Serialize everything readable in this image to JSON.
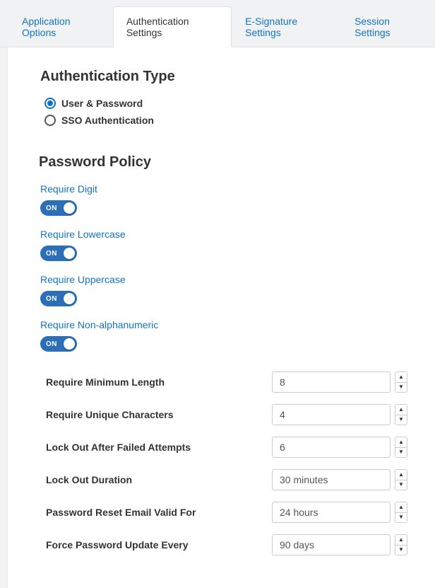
{
  "tabs": {
    "application_options": "Application Options",
    "authentication_settings": "Authentication Settings",
    "esignature_settings": "E-Signature Settings",
    "session_settings": "Session Settings"
  },
  "auth_type": {
    "title": "Authentication Type",
    "user_password": "User & Password",
    "sso": "SSO Authentication"
  },
  "password_policy": {
    "title": "Password Policy",
    "require_digit": "Require Digit",
    "require_lowercase": "Require Lowercase",
    "require_uppercase": "Require Uppercase",
    "require_nonalpha": "Require Non-alphanumeric",
    "on": "ON",
    "fields": {
      "min_length_label": "Require Minimum Length",
      "min_length_value": "8",
      "unique_chars_label": "Require Unique Characters",
      "unique_chars_value": "4",
      "lockout_attempts_label": "Lock Out After Failed Attempts",
      "lockout_attempts_value": "6",
      "lockout_duration_label": "Lock Out Duration",
      "lockout_duration_value": "30 minutes",
      "reset_valid_label": "Password Reset Email Valid For",
      "reset_valid_value": "24 hours",
      "force_update_label": "Force Password Update Every",
      "force_update_value": "90 days"
    }
  }
}
